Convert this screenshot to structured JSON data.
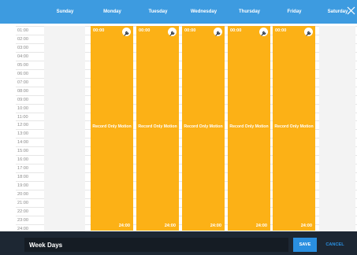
{
  "colors": {
    "header": "#3d9be0",
    "schedule_block": "#fcb116",
    "footer": "#1d2733",
    "save_button": "#2a8fe0",
    "cancel_text": "#2a8fe0"
  },
  "days": [
    "Sunday",
    "Monday",
    "Tuesday",
    "Wednesday",
    "Thursday",
    "Friday",
    "Saturday"
  ],
  "hours": [
    "01:00",
    "02:00",
    "03:00",
    "04:00",
    "05:00",
    "06:00",
    "07:00",
    "08:00",
    "09:00",
    "10:00",
    "11:00",
    "12:00",
    "13:00",
    "14:00",
    "15:00",
    "16:00",
    "17:00",
    "18:00",
    "19:00",
    "20:00",
    "21:00",
    "22:00",
    "23:00",
    "24:00"
  ],
  "blocks": [
    {
      "day": "Monday",
      "start": "00:00",
      "end": "24:00",
      "mode": "Record Only Motion",
      "icon": "wrench-icon"
    },
    {
      "day": "Tuesday",
      "start": "00:00",
      "end": "24:00",
      "mode": "Record Only Motion",
      "icon": "wrench-icon"
    },
    {
      "day": "Wednesday",
      "start": "00:00",
      "end": "24:00",
      "mode": "Record Only Motion",
      "icon": "wrench-icon"
    },
    {
      "day": "Thursday",
      "start": "00:00",
      "end": "24:00",
      "mode": "Record Only Motion",
      "icon": "wrench-icon"
    },
    {
      "day": "Friday",
      "start": "00:00",
      "end": "24:00",
      "mode": "Record Only Motion",
      "icon": "wrench-icon"
    }
  ],
  "footer": {
    "schedule_name": "Week Days",
    "save_label": "SAVE",
    "cancel_label": "CANCEL"
  },
  "close_icon": "close-icon"
}
